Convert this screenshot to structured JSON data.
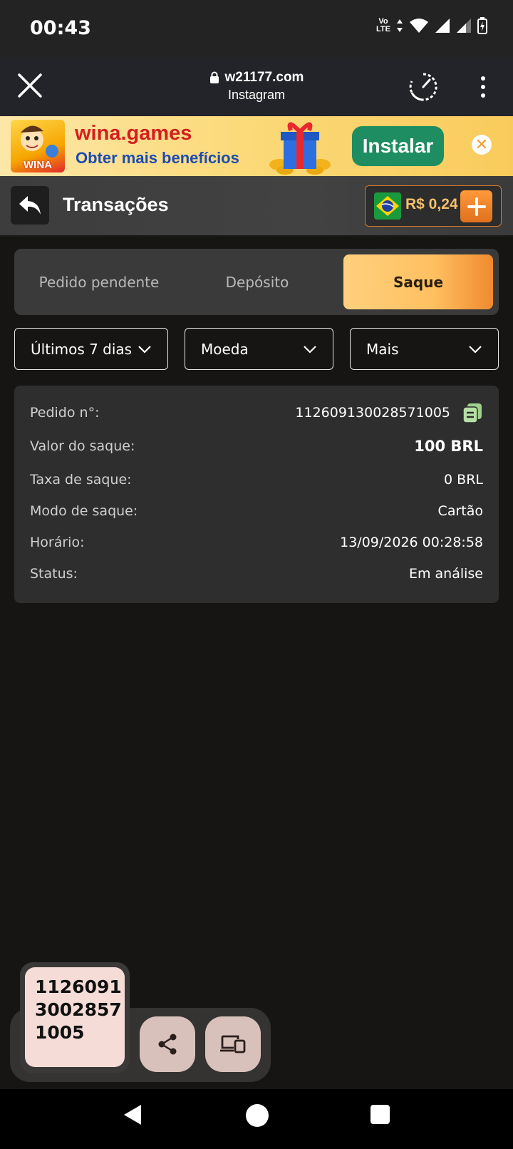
{
  "status_bar": {
    "time": "00:43",
    "volte_label_1": "Vo",
    "volte_label_2": "LTE"
  },
  "browser": {
    "domain": "w21177.com",
    "source": "Instagram"
  },
  "ad": {
    "title": "wina.games",
    "subtitle": "Obter mais benefícios",
    "install_label": "Instalar",
    "logo_text": "WINA",
    "close_glyph": "✕"
  },
  "header": {
    "title": "Transações",
    "balance": "R$ 0,24"
  },
  "tabs": [
    {
      "label": "Pedido pendente",
      "active": false
    },
    {
      "label": "Depósito",
      "active": false
    },
    {
      "label": "Saque",
      "active": true
    }
  ],
  "filters": [
    {
      "label": "Últimos 7 dias"
    },
    {
      "label": "Moeda"
    },
    {
      "label": "Mais"
    }
  ],
  "transaction": {
    "rows": [
      {
        "label": "Pedido n°:",
        "value": "112609130028571005"
      },
      {
        "label": "Valor do saque:",
        "value": "100 BRL"
      },
      {
        "label": "Taxa de saque:",
        "value": "0 BRL"
      },
      {
        "label": "Modo de saque:",
        "value": "Cartão"
      },
      {
        "label": "Horário:",
        "value": "13/09/2026 00:28:58"
      },
      {
        "label": "Status:",
        "value": "Em análise"
      }
    ]
  },
  "clipboard": {
    "text": "112609130028571005"
  },
  "colors": {
    "accent": "#f08a2e",
    "tab_active_start": "#ffd07d",
    "install_green": "#1e8d61",
    "ad_title_red": "#d41f1f"
  },
  "icons": [
    "close-icon",
    "lock-icon",
    "speed-icon",
    "more-vert-icon",
    "back-arrow-icon",
    "brazil-flag-icon",
    "plus-icon",
    "chevron-down-icon",
    "copy-icon",
    "share-icon",
    "devices-icon"
  ]
}
